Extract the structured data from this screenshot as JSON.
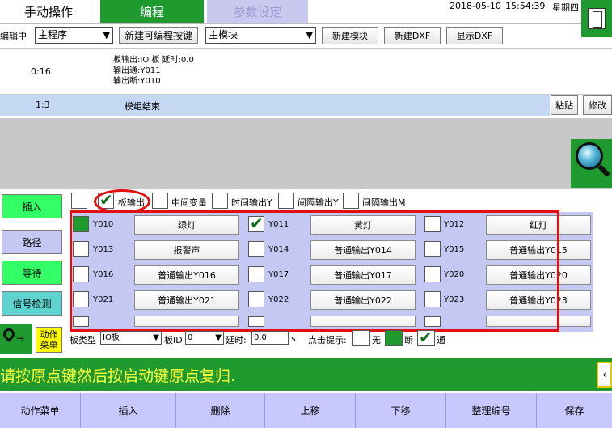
{
  "tabs": {
    "manual": "手动操作",
    "program": "编程",
    "params": "参数设定"
  },
  "clock": {
    "date": "2018-05-10",
    "time": "15:54:39",
    "weekday": "星期四"
  },
  "editor": {
    "editing_label": "编辑中",
    "program_select": "主程序",
    "new_programmable_key": "新建可编程按键",
    "module_select": "主模块",
    "new_module": "新建模块",
    "new_dxf": "新建DXF",
    "show_dxf": "显示DXF"
  },
  "program_rows": [
    {
      "index": "0:16",
      "lines": [
        "板输出:IO 板 延时:0.0",
        "输出通:Y011",
        "输出断:Y010"
      ]
    },
    {
      "index": "1:3",
      "lines": [
        "模组结束"
      ]
    }
  ],
  "row_actions": {
    "paste": "粘贴",
    "modify": "修改"
  },
  "side_buttons": {
    "insert": "插入",
    "path": "路径",
    "wait": "等待",
    "signal_detect": "信号检测",
    "action_menu": "动作菜单"
  },
  "output_types": {
    "board_output": "板输出",
    "middle_var": "中间变量",
    "timed_output": "时间输出Y",
    "interval_y": "间隔输出Y",
    "interval_m": "间隔输出M"
  },
  "io_items": [
    {
      "code": "Y010",
      "label": "绿灯",
      "state": "on"
    },
    {
      "code": "Y011",
      "label": "黄灯",
      "state": "checked"
    },
    {
      "code": "Y012",
      "label": "红灯",
      "state": "off"
    },
    {
      "code": "Y013",
      "label": "报警声",
      "state": "off"
    },
    {
      "code": "Y014",
      "label": "普通输出Y014",
      "state": "off"
    },
    {
      "code": "Y015",
      "label": "普通输出Y015",
      "state": "off"
    },
    {
      "code": "Y016",
      "label": "普通输出Y016",
      "state": "off"
    },
    {
      "code": "Y017",
      "label": "普通输出Y017",
      "state": "off"
    },
    {
      "code": "Y020",
      "label": "普通输出Y020",
      "state": "off"
    },
    {
      "code": "Y021",
      "label": "普通输出Y021",
      "state": "off"
    },
    {
      "code": "Y022",
      "label": "普通输出Y022",
      "state": "off"
    },
    {
      "code": "Y023",
      "label": "普通输出Y023",
      "state": "off"
    }
  ],
  "options": {
    "board_type_label": "板类型",
    "board_type_value": "IO板",
    "board_id_label": "板ID",
    "board_id_value": "0",
    "delay_label": "延时:",
    "delay_value": "0.0",
    "delay_unit": "s",
    "click_hint_label": "点击提示:",
    "hint_none": "无",
    "hint_off": "断",
    "hint_on": "通"
  },
  "message": "请按原点键然后按启动键原点复归.",
  "bottom_buttons": [
    "动作菜单",
    "插入",
    "删除",
    "上移",
    "下移",
    "整理编号",
    "保存"
  ],
  "colors": {
    "accent_green": "#1f9a2e",
    "panel_lavender": "#c5c8f2",
    "highlight_red": "#e01010",
    "message_yellow": "#ffff3a"
  }
}
